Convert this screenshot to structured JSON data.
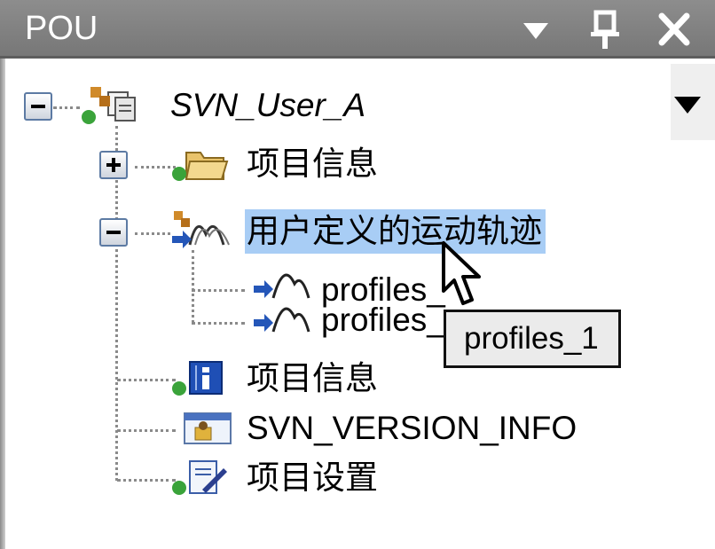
{
  "panel": {
    "title": "POU",
    "buttons": [
      {
        "name": "dropdown-button",
        "icon": "triangle-down-icon"
      },
      {
        "name": "pin-button",
        "icon": "pin-icon"
      },
      {
        "name": "close-button",
        "icon": "close-icon"
      }
    ]
  },
  "tree": {
    "root": {
      "label": "SVN_User_A",
      "expanded": true,
      "icon": "svn-project-icon"
    },
    "children": [
      {
        "label": "项目信息",
        "expanded": false,
        "icon": "folder-icon"
      },
      {
        "label": "用户定义的运动轨迹",
        "expanded": true,
        "selected": true,
        "icon": "motion-profile-folder-icon",
        "children": [
          {
            "label": "profiles_",
            "icon": "cam-profile-icon"
          },
          {
            "label": "profiles_",
            "icon": "cam-profile-icon"
          }
        ]
      },
      {
        "label": "项目信息",
        "icon": "info-icon"
      },
      {
        "label": "SVN_VERSION_INFO",
        "icon": "version-info-icon"
      },
      {
        "label": "项目设置",
        "icon": "settings-icon"
      }
    ]
  },
  "tooltip": {
    "text": "profiles_1"
  },
  "colors": {
    "titlebar": "#808080",
    "selection": "#a8cdf5",
    "tooltip_bg": "#ebebeb"
  }
}
